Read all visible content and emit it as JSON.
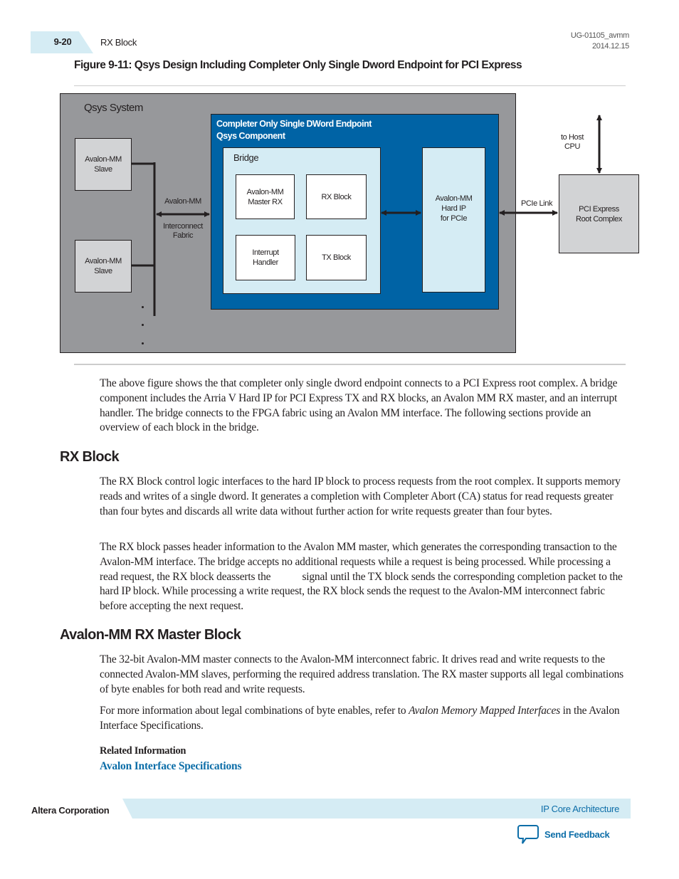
{
  "header": {
    "page_number": "9-20",
    "section": "RX Block",
    "doc_id": "UG-01105_avmm",
    "doc_date": "2014.12.15"
  },
  "figure": {
    "title": "Figure 9-11: Qsys Design Including Completer Only Single Dword Endpoint for PCI Express",
    "qsys_system_label": "Qsys System",
    "slave_1": [
      "Avalon-MM",
      "Slave"
    ],
    "slave_2": [
      "Avalon-MM",
      "Slave"
    ],
    "interconnect_top": "Avalon-MM",
    "interconnect_bottom": [
      "Interconnect",
      "Fabric"
    ],
    "component_label": [
      "Completer Only Single DWord Endpoint",
      "Qsys Component"
    ],
    "bridge_label": "Bridge",
    "master_rx": [
      "Avalon-MM",
      "Master RX"
    ],
    "rx_block": "RX Block",
    "interrupt_handler": [
      "Interrupt",
      "Handler"
    ],
    "tx_block": "TX Block",
    "hard_ip": [
      "Avalon-MM",
      "Hard IP",
      "for PCIe"
    ],
    "pcie_link": "PCIe Link",
    "to_host": [
      "to Host",
      "CPU"
    ],
    "root_complex": [
      "PCI Express",
      "Root Complex"
    ]
  },
  "intro_paragraph": "The above figure shows the that completer only single dword endpoint connects to a PCI Express root complex. A bridge component includes the Arria V Hard IP for PCI Express TX and RX blocks, an Avalon MM RX master, and an interrupt handler. The bridge connects to the FPGA fabric using an Avalon MM interface. The following sections provide an overview of each block in the bridge.",
  "rx_block": {
    "heading": "RX Block",
    "p1": "The RX Block control logic interfaces to the hard IP block to process requests from the root complex. It supports memory reads and writes of a single dword. It generates a completion with Completer Abort (CA) status for read requests greater than four bytes and discards all write data without further action for write requests greater than four bytes.",
    "p2": "The RX block passes header information to the Avalon MM master, which generates the corresponding transaction to the Avalon-MM interface. The bridge accepts no additional requests while a request is being processed. While processing a read request, the RX block deasserts the            signal until the TX block sends the corresponding completion packet to the hard IP block. While processing a write request, the RX block sends the request to the Avalon-MM interconnect fabric before accepting the next request."
  },
  "rx_master": {
    "heading": "Avalon-MM RX Master Block",
    "p1": "The 32-bit Avalon-MM master connects to the Avalon-MM interconnect fabric. It drives read and write requests to the connected Avalon-MM slaves, performing the required address translation. The RX master supports all legal combinations of byte enables for both read and write requests.",
    "p2_before": "For more information about legal combinations of byte enables, refer to ",
    "p2_italic": "Avalon Memory Mapped Interfaces",
    "p2_after": " in the Avalon Interface Specifications.",
    "related_label": "Related Information",
    "related_link": "Avalon Interface Specifications"
  },
  "footer": {
    "company": "Altera Corporation",
    "chapter": "IP Core Architecture",
    "feedback": "Send Feedback"
  }
}
